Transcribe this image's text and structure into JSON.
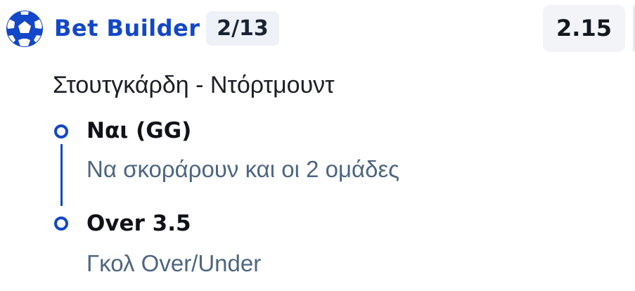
{
  "header": {
    "icon": "soccer-ball-icon",
    "title": "Bet Builder",
    "count_badge": "2/13",
    "odds": "2.15"
  },
  "match": {
    "name": "Στουτγκάρδη - Ντόρτμουντ"
  },
  "selections": [
    {
      "title": "Ναι (GG)",
      "market": "Να σκοράρουν και οι 2 ομάδες"
    },
    {
      "title": "Over 3.5",
      "market": "Γκολ Over/Under"
    }
  ],
  "colors": {
    "accent": "#1347c9",
    "badge_bg": "#eef1f7",
    "odds_bg": "#f2f4f8",
    "market_text": "#4d6680"
  }
}
